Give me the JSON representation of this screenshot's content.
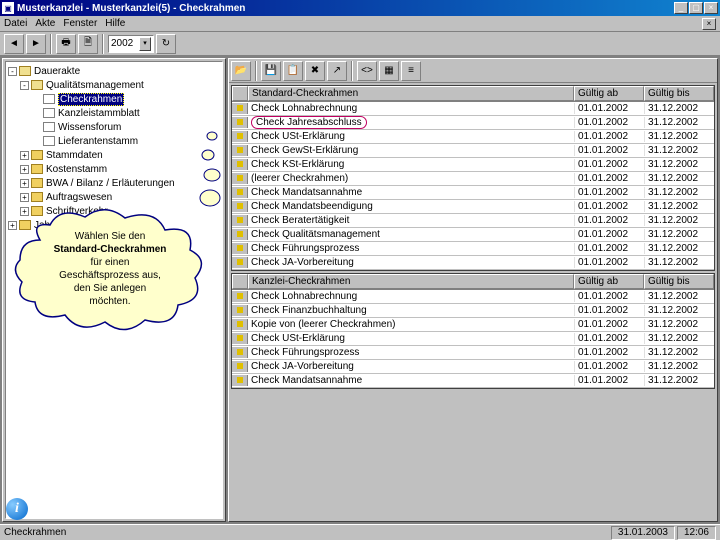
{
  "title": "Musterkanzlei - Musterkanzlei(5) - Checkrahmen",
  "menu": [
    "Datei",
    "Akte",
    "Fenster",
    "Hilfe"
  ],
  "main_toolbar": {
    "year": "2002"
  },
  "tree": [
    {
      "lvl": 0,
      "exp": "-",
      "ico": "fld-o",
      "t": "Dauerakte"
    },
    {
      "lvl": 1,
      "exp": "-",
      "ico": "fld-o",
      "t": "Qualitätsmanagement"
    },
    {
      "lvl": 2,
      "exp": "",
      "ico": "doc",
      "t": "Checkrahmen",
      "sel": true
    },
    {
      "lvl": 2,
      "exp": "",
      "ico": "doc",
      "t": "Kanzleistammblatt"
    },
    {
      "lvl": 2,
      "exp": "",
      "ico": "doc",
      "t": "Wissensforum"
    },
    {
      "lvl": 2,
      "exp": "",
      "ico": "doc",
      "t": "Lieferantenstamm"
    },
    {
      "lvl": 1,
      "exp": "+",
      "ico": "fld-c",
      "t": "Stammdaten"
    },
    {
      "lvl": 1,
      "exp": "+",
      "ico": "fld-c",
      "t": "Kostenstamm"
    },
    {
      "lvl": 1,
      "exp": "+",
      "ico": "fld-c",
      "t": "BWA / Bilanz / Erläuterungen"
    },
    {
      "lvl": 1,
      "exp": "+",
      "ico": "fld-c",
      "t": "Auftragswesen"
    },
    {
      "lvl": 1,
      "exp": "+",
      "ico": "fld-c",
      "t": "Schriftverkehr"
    },
    {
      "lvl": 0,
      "exp": "+",
      "ico": "fld-c",
      "t": "Jahresakte"
    }
  ],
  "cloud": {
    "line1": "Wählen Sie den",
    "line2": "Standard-Checkrahmen",
    "line3": "für einen",
    "line4": "Geschäftsprozess aus,",
    "line5": "den Sie anlegen",
    "line6": "möchten."
  },
  "table1": {
    "title": "Standard-Checkrahmen",
    "cols": [
      "",
      "Standard-Checkrahmen",
      "Gültig ab",
      "Gültig bis"
    ],
    "rows": [
      {
        "n": "Check Lohnabrechnung",
        "a": "01.01.2002",
        "b": "31.12.2002"
      },
      {
        "n": "Check Jahresabschluss",
        "a": "01.01.2002",
        "b": "31.12.2002",
        "hl": true
      },
      {
        "n": "Check USt-Erklärung",
        "a": "01.01.2002",
        "b": "31.12.2002"
      },
      {
        "n": "Check GewSt-Erklärung",
        "a": "01.01.2002",
        "b": "31.12.2002"
      },
      {
        "n": "Check KSt-Erklärung",
        "a": "01.01.2002",
        "b": "31.12.2002"
      },
      {
        "n": "(leerer Checkrahmen)",
        "a": "01.01.2002",
        "b": "31.12.2002"
      },
      {
        "n": "Check Mandatsannahme",
        "a": "01.01.2002",
        "b": "31.12.2002"
      },
      {
        "n": "Check Mandatsbeendigung",
        "a": "01.01.2002",
        "b": "31.12.2002"
      },
      {
        "n": "Check Beratertätigkeit",
        "a": "01.01.2002",
        "b": "31.12.2002"
      },
      {
        "n": "Check Qualitätsmanagement",
        "a": "01.01.2002",
        "b": "31.12.2002"
      },
      {
        "n": "Check Führungsprozess",
        "a": "01.01.2002",
        "b": "31.12.2002"
      },
      {
        "n": "Check JA-Vorbereitung",
        "a": "01.01.2002",
        "b": "31.12.2002"
      }
    ]
  },
  "table2": {
    "cols": [
      "",
      "Kanzlei-Checkrahmen",
      "Gültig ab",
      "Gültig bis"
    ],
    "rows": [
      {
        "n": "Check Lohnabrechnung",
        "a": "01.01.2002",
        "b": "31.12.2002"
      },
      {
        "n": "Check Finanzbuchhaltung",
        "a": "01.01.2002",
        "b": "31.12.2002"
      },
      {
        "n": "Kopie von (leerer Checkrahmen)",
        "a": "01.01.2002",
        "b": "31.12.2002"
      },
      {
        "n": "Check USt-Erklärung",
        "a": "01.01.2002",
        "b": "31.12.2002"
      },
      {
        "n": "Check Führungsprozess",
        "a": "01.01.2002",
        "b": "31.12.2002"
      },
      {
        "n": "Check JA-Vorbereitung",
        "a": "01.01.2002",
        "b": "31.12.2002"
      },
      {
        "n": "Check Mandatsannahme",
        "a": "01.01.2002",
        "b": "31.12.2002"
      }
    ]
  },
  "status": {
    "left": "Checkrahmen",
    "date": "31.01.2003",
    "time": "12:06"
  }
}
